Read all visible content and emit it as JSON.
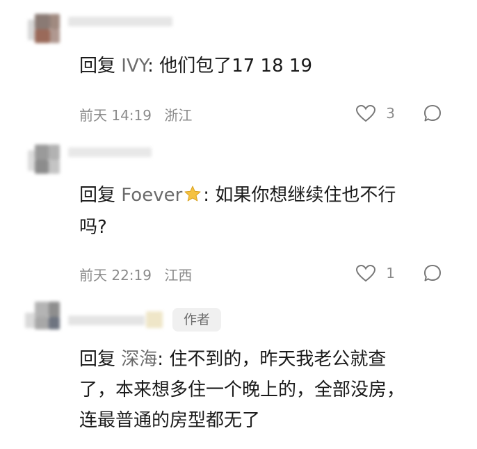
{
  "comments": [
    {
      "reply_prefix": "回复",
      "reply_to": "IVY",
      "separator": ":",
      "text": "他们包了17 18 19",
      "date": "前天 14:19",
      "location": "浙江",
      "likes": "3"
    },
    {
      "reply_prefix": "回复",
      "reply_to": "Foever",
      "separator": ":",
      "text_line1": "如果你想继续住也不行",
      "text_line2": "吗?",
      "date": "前天 22:19",
      "location": "江西",
      "likes": "1"
    },
    {
      "author_badge": "作者",
      "reply_prefix": "回复",
      "reply_to": "深海",
      "separator": ":",
      "text_line1": "住不到的，昨天我老公就查",
      "text_line2": "了，本来想多住一个晚上的，全部没房，",
      "text_line3": "连最普通的房型都无了"
    }
  ],
  "colors": {
    "meta": "#8a8a8a",
    "reply_name": "#6b6b6b",
    "badge_bg": "#f0f0f0",
    "star": "#f5c242"
  },
  "icons": [
    "heart-icon",
    "comment-bubble-icon",
    "star-icon"
  ]
}
